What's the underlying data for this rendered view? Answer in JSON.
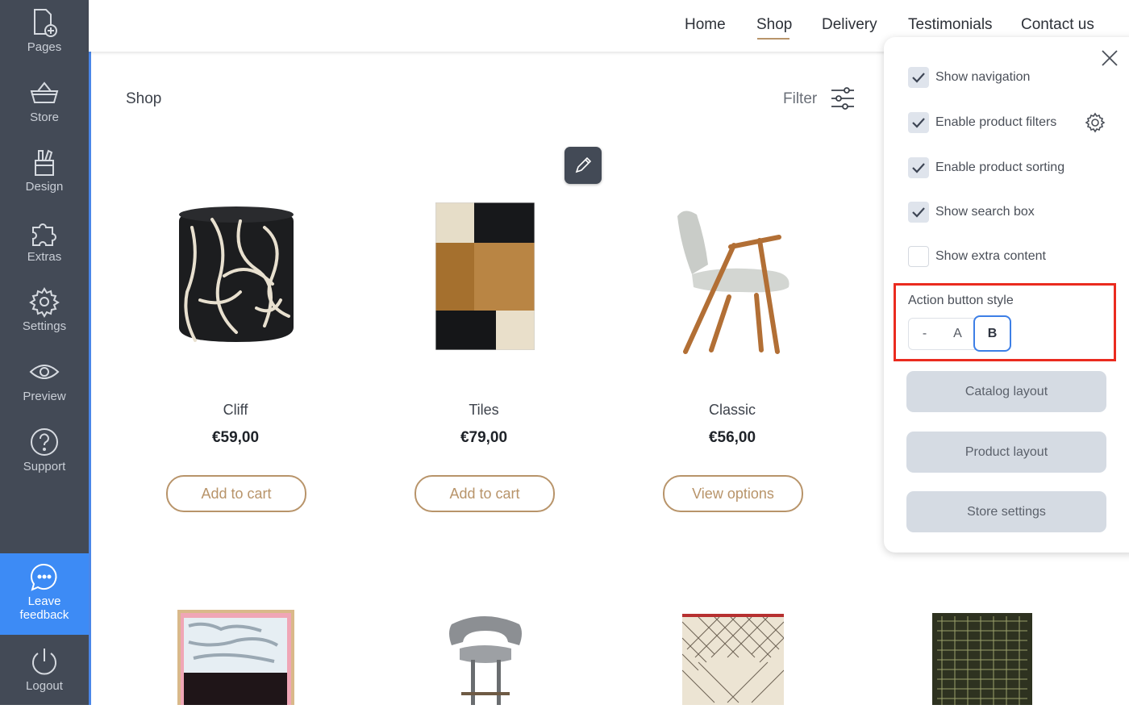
{
  "sidebar": {
    "items": [
      {
        "label": "Pages",
        "icon": "page-add-icon"
      },
      {
        "label": "Store",
        "icon": "basket-icon"
      },
      {
        "label": "Design",
        "icon": "design-tools-icon"
      },
      {
        "label": "Extras",
        "icon": "puzzle-icon"
      },
      {
        "label": "Settings",
        "icon": "gear-icon"
      },
      {
        "label": "Preview",
        "icon": "eye-icon"
      },
      {
        "label": "Support",
        "icon": "question-icon"
      }
    ],
    "feedback_line1": "Leave",
    "feedback_line2": "feedback",
    "logout": "Logout"
  },
  "nav": {
    "home": "Home",
    "shop": "Shop",
    "delivery": "Delivery",
    "testimonials": "Testimonials",
    "contact": "Contact us",
    "active": "Shop"
  },
  "shop": {
    "title": "Shop",
    "filter_label": "Filter"
  },
  "products": [
    {
      "name": "Cliff",
      "price": "€59,00",
      "action": "Add to cart"
    },
    {
      "name": "Tiles",
      "price": "€79,00",
      "action": "Add to cart"
    },
    {
      "name": "Classic",
      "price": "€56,00",
      "action": "View options"
    }
  ],
  "panel": {
    "options": [
      {
        "label": "Show navigation",
        "checked": true
      },
      {
        "label": "Enable product filters",
        "checked": true
      },
      {
        "label": "Enable product sorting",
        "checked": true
      },
      {
        "label": "Show search box",
        "checked": true
      },
      {
        "label": "Show extra content",
        "checked": false
      }
    ],
    "action_button_style": {
      "title": "Action button style",
      "options": [
        "-",
        "A",
        "B"
      ],
      "selected": "B"
    },
    "buttons": {
      "catalog": "Catalog layout",
      "product": "Product layout",
      "store": "Store settings"
    }
  },
  "colors": {
    "sidebar_bg": "#434a56",
    "accent_gold": "#b8946a",
    "feedback_blue": "#3d8bf5",
    "highlight_red": "#ea2b1f",
    "selected_blue": "#3d7fe6"
  }
}
